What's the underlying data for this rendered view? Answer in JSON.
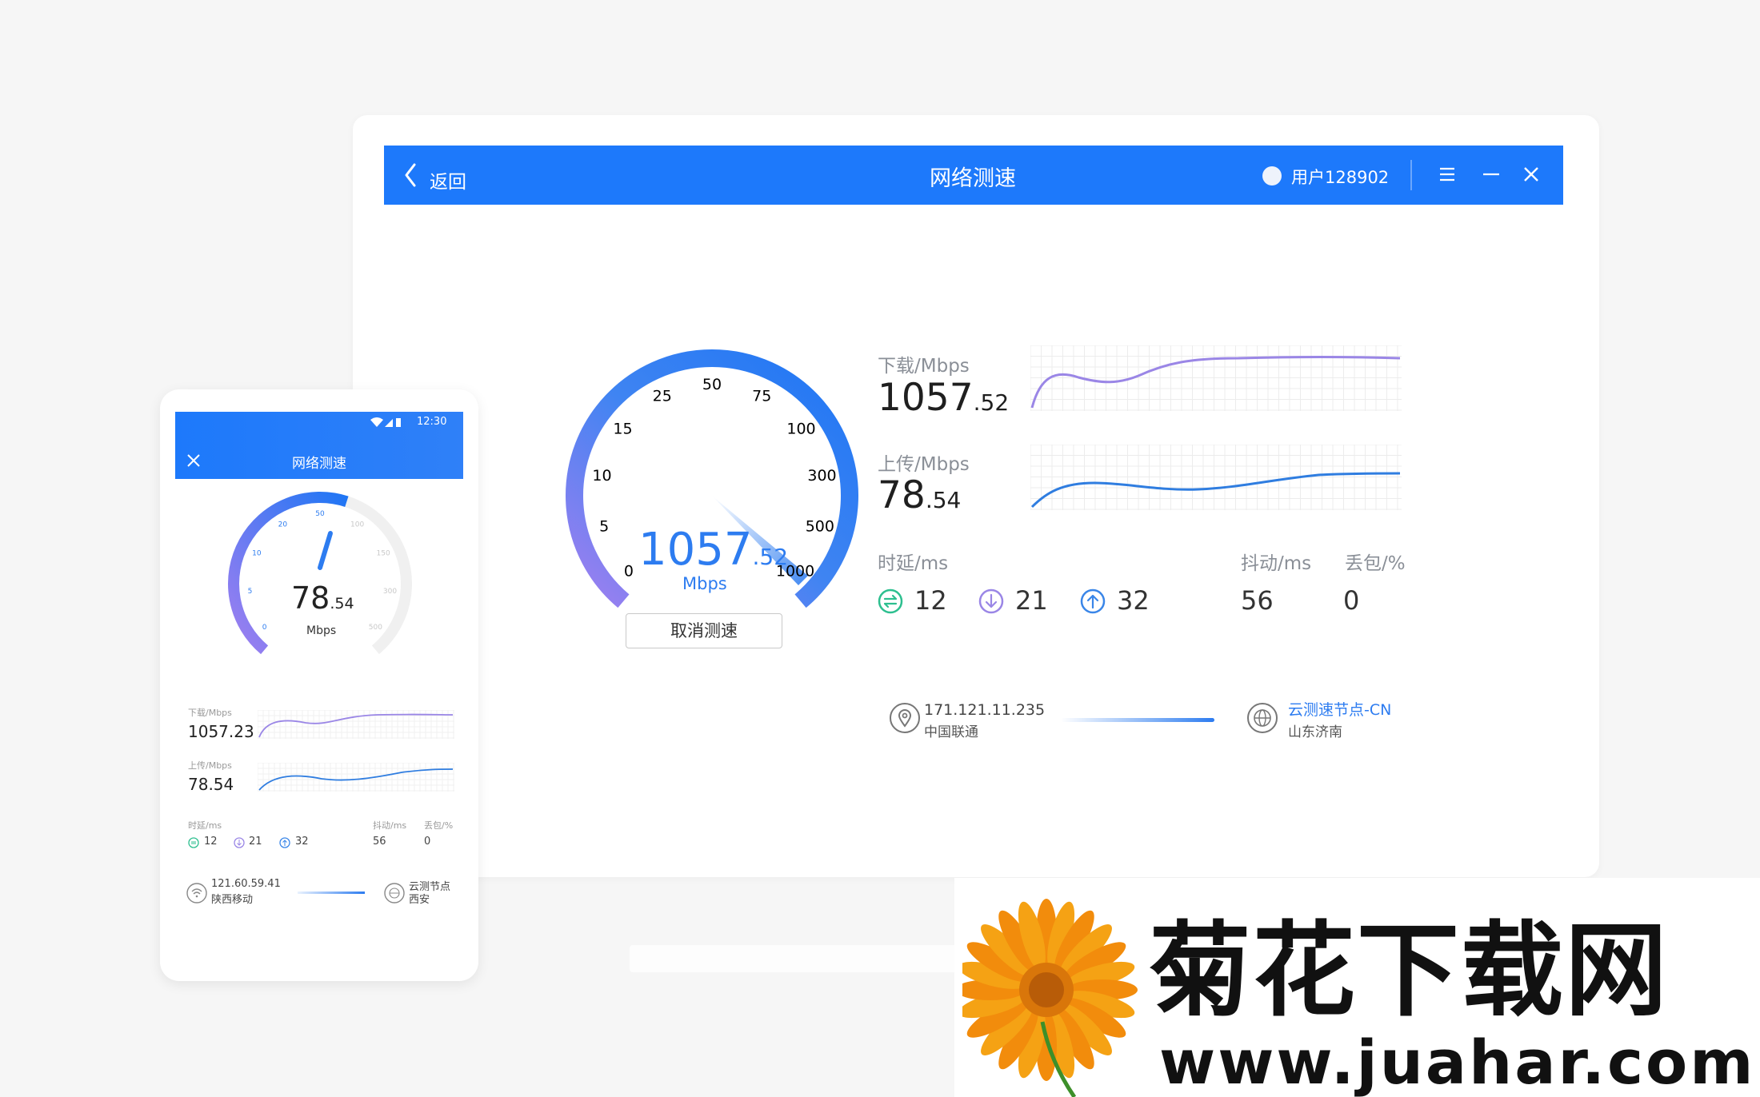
{
  "desktop": {
    "titlebar": {
      "back_label": "返回",
      "title": "网络测速",
      "user_label": "用户128902"
    },
    "gauge": {
      "ticks": [
        "0",
        "5",
        "10",
        "15",
        "25",
        "50",
        "75",
        "100",
        "300",
        "500",
        "1000"
      ],
      "value_int": "1057",
      "value_dec": ".52",
      "unit": "Mbps",
      "cancel_label": "取消测速"
    },
    "download": {
      "label": "下载/Mbps",
      "value_int": "1057",
      "value_dec": ".52"
    },
    "upload": {
      "label": "上传/Mbps",
      "value_int": "78",
      "value_dec": ".54"
    },
    "latency": {
      "label": "时延/ms",
      "values": [
        "12",
        "21",
        "32"
      ]
    },
    "jitter": {
      "label": "抖动/ms",
      "value": "56"
    },
    "loss": {
      "label": "丢包/%",
      "value": "0"
    },
    "client": {
      "ip": "171.121.11.235",
      "isp": "中国联通"
    },
    "server": {
      "name": "云测速节点-CN",
      "location": "山东济南"
    }
  },
  "phone": {
    "status_time": "12:30",
    "title": "网络测速",
    "gauge": {
      "ticks": [
        "0",
        "5",
        "10",
        "20",
        "50",
        "100",
        "150",
        "300",
        "500"
      ],
      "value_int": "78",
      "value_dec": ".54",
      "unit": "Mbps"
    },
    "download": {
      "label": "下载/Mbps",
      "value": "1057.23"
    },
    "upload": {
      "label": "上传/Mbps",
      "value": "78.54"
    },
    "latency": {
      "label": "时延/ms",
      "values": [
        "12",
        "21",
        "32"
      ]
    },
    "jitter": {
      "label": "抖动/ms",
      "value": "56"
    },
    "loss": {
      "label": "丢包/%",
      "value": "0"
    },
    "client": {
      "ip": "121.60.59.41",
      "isp": "陕西移动"
    },
    "server": {
      "name": "云测节点",
      "location": "西安"
    }
  },
  "watermark": {
    "name": "菊花下载网",
    "url": "www.juahar.com"
  },
  "colors": {
    "primary": "#1d79fb",
    "gauge_start": "#9b7ff0",
    "gauge_end": "#2d7cf0",
    "download_line": "#9a86e6",
    "upload_line": "#2f7de0",
    "latency_green": "#2dbf8f",
    "latency_purple": "#9a86e6",
    "latency_blue": "#3a86e8"
  }
}
